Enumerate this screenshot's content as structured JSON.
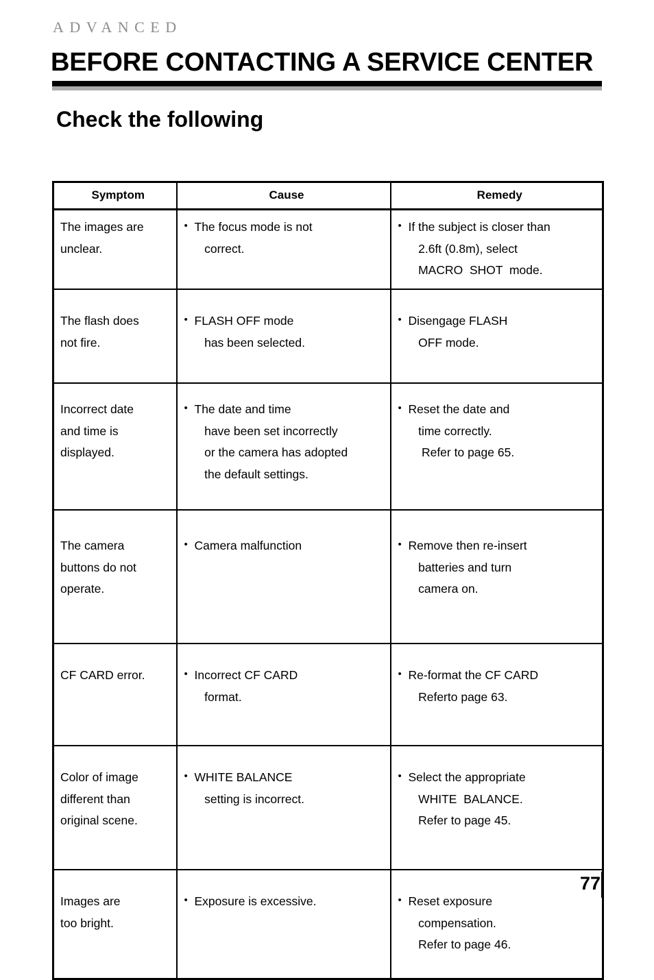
{
  "header": {
    "kicker": "ADVANCED",
    "chapter_title": "BEFORE CONTACTING A SERVICE CENTER",
    "section_title": "Check the following",
    "rule_black_color": "#000000",
    "rule_gray_color": "#aaaaaa",
    "kicker_color": "#8d8d8d"
  },
  "table": {
    "columns": [
      "Symptom",
      "Cause",
      "Remedy"
    ],
    "rows": [
      {
        "symptom": "The images are\nunclear.",
        "cause": "The focus mode is not\n   correct.",
        "remedy": "If the subject is closer than\n   2.6ft (0.8m), select\n   MACRO  SHOT  mode."
      },
      {
        "symptom": "The flash does\nnot fire.",
        "cause": "FLASH OFF mode\n   has been selected.",
        "remedy": "Disengage FLASH\n   OFF mode."
      },
      {
        "symptom": "Incorrect date\nand time is\ndisplayed.",
        "cause": "The date and time\n   have been set incorrectly\n   or the camera has adopted\n   the default settings.",
        "remedy": "Reset the date and\n   time correctly.\n    Refer to page 65."
      },
      {
        "symptom": "The camera\nbuttons do not\noperate.",
        "cause": "Camera malfunction",
        "remedy": "Remove then re-insert\n   batteries and turn\n   camera on."
      },
      {
        "symptom": "CF CARD error.",
        "cause": "Incorrect CF CARD\n   format.",
        "remedy": "Re-format the CF CARD\n   Referto page 63."
      },
      {
        "symptom": "Color of image\ndifferent than\noriginal scene.",
        "cause": "WHITE BALANCE\n   setting is incorrect.",
        "remedy": "Select the appropriate\n   WHITE  BALANCE.\n   Refer to page 45."
      },
      {
        "symptom": "Images are\ntoo bright.",
        "cause": "Exposure is excessive.",
        "remedy": "Reset exposure\n   compensation.\n   Refer to page 46."
      }
    ]
  },
  "footer": {
    "page_number": "77"
  }
}
